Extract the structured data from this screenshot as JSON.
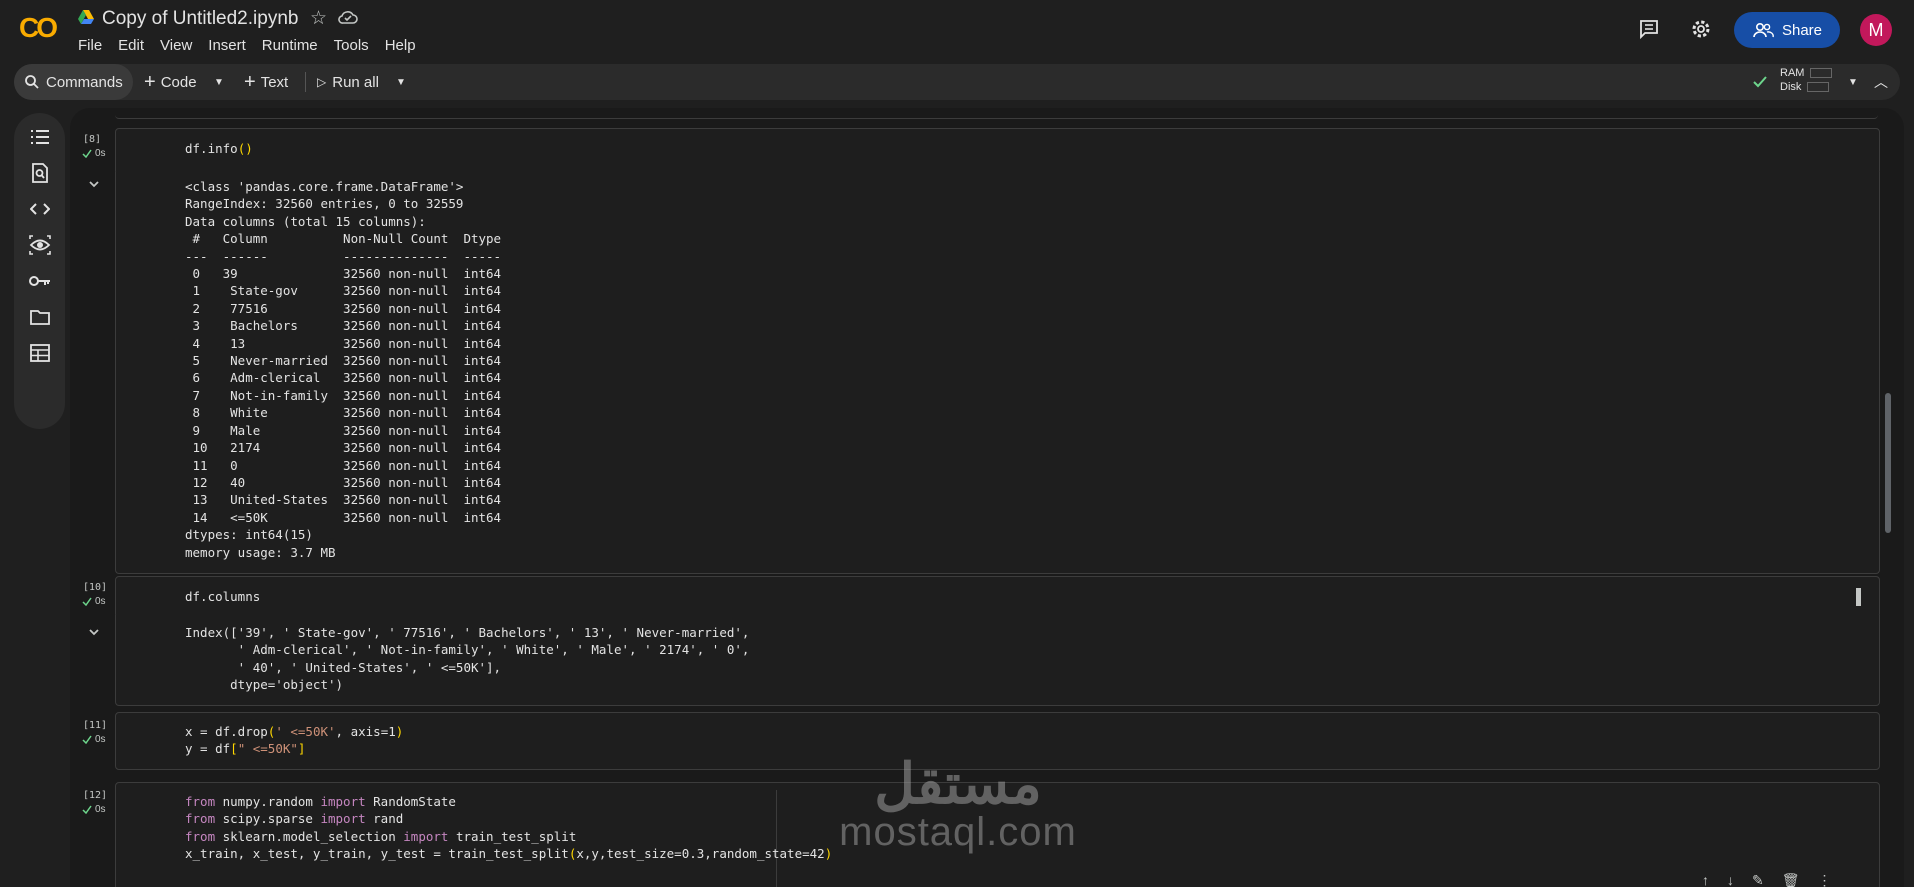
{
  "app": {
    "logo_text": "CO",
    "title": "Copy of Untitled2.ipynb"
  },
  "menu": [
    "File",
    "Edit",
    "View",
    "Insert",
    "Runtime",
    "Tools",
    "Help"
  ],
  "header": {
    "share_label": "Share",
    "avatar_letter": "M"
  },
  "toolbar": {
    "commands_label": "Commands",
    "code_label": "Code",
    "text_label": "Text",
    "run_all_label": "Run all",
    "ram_label": "RAM",
    "disk_label": "Disk"
  },
  "colors": {
    "logo": "#f9ab00",
    "share_button": "#174ea6",
    "avatar": "#c2185b",
    "status_check": "#6dd58c"
  },
  "cells": [
    {
      "number": "[8]",
      "status": "0s",
      "code": "df.info()",
      "output": "<class 'pandas.core.frame.DataFrame'>\nRangeIndex: 32560 entries, 0 to 32559\nData columns (total 15 columns):\n #   Column          Non-Null Count  Dtype\n---  ------          --------------  -----\n 0   39              32560 non-null  int64\n 1    State-gov      32560 non-null  int64\n 2    77516          32560 non-null  int64\n 3    Bachelors      32560 non-null  int64\n 4    13             32560 non-null  int64\n 5    Never-married  32560 non-null  int64\n 6    Adm-clerical   32560 non-null  int64\n 7    Not-in-family  32560 non-null  int64\n 8    White          32560 non-null  int64\n 9    Male           32560 non-null  int64\n 10   2174           32560 non-null  int64\n 11   0              32560 non-null  int64\n 12   40             32560 non-null  int64\n 13   United-States  32560 non-null  int64\n 14   <=50K          32560 non-null  int64\ndtypes: int64(15)\nmemory usage: 3.7 MB"
    },
    {
      "number": "[10]",
      "status": "0s",
      "code": "df.columns",
      "output": "Index(['39', ' State-gov', ' 77516', ' Bachelors', ' 13', ' Never-married',\n       ' Adm-clerical', ' Not-in-family', ' White', ' Male', ' 2174', ' 0',\n       ' 40', ' United-States', ' <=50K'],\n      dtype='object')"
    },
    {
      "number": "[11]",
      "status": "0s",
      "code_lines": [
        "x = df.drop(' <=50K', axis=1)",
        "y = df[\" <=50K\"]"
      ]
    },
    {
      "number": "[12]",
      "status": "0s",
      "code_lines": [
        "from numpy.random import RandomState",
        "from scipy.sparse import rand",
        "from sklearn.model_selection import train_test_split",
        "x_train, x_test, y_train, y_test = train_test_split(x,y,test_size=0.3,random_state=42)"
      ]
    }
  ],
  "watermark": {
    "arabic": "مستقل",
    "latin": "mostaql.com"
  }
}
